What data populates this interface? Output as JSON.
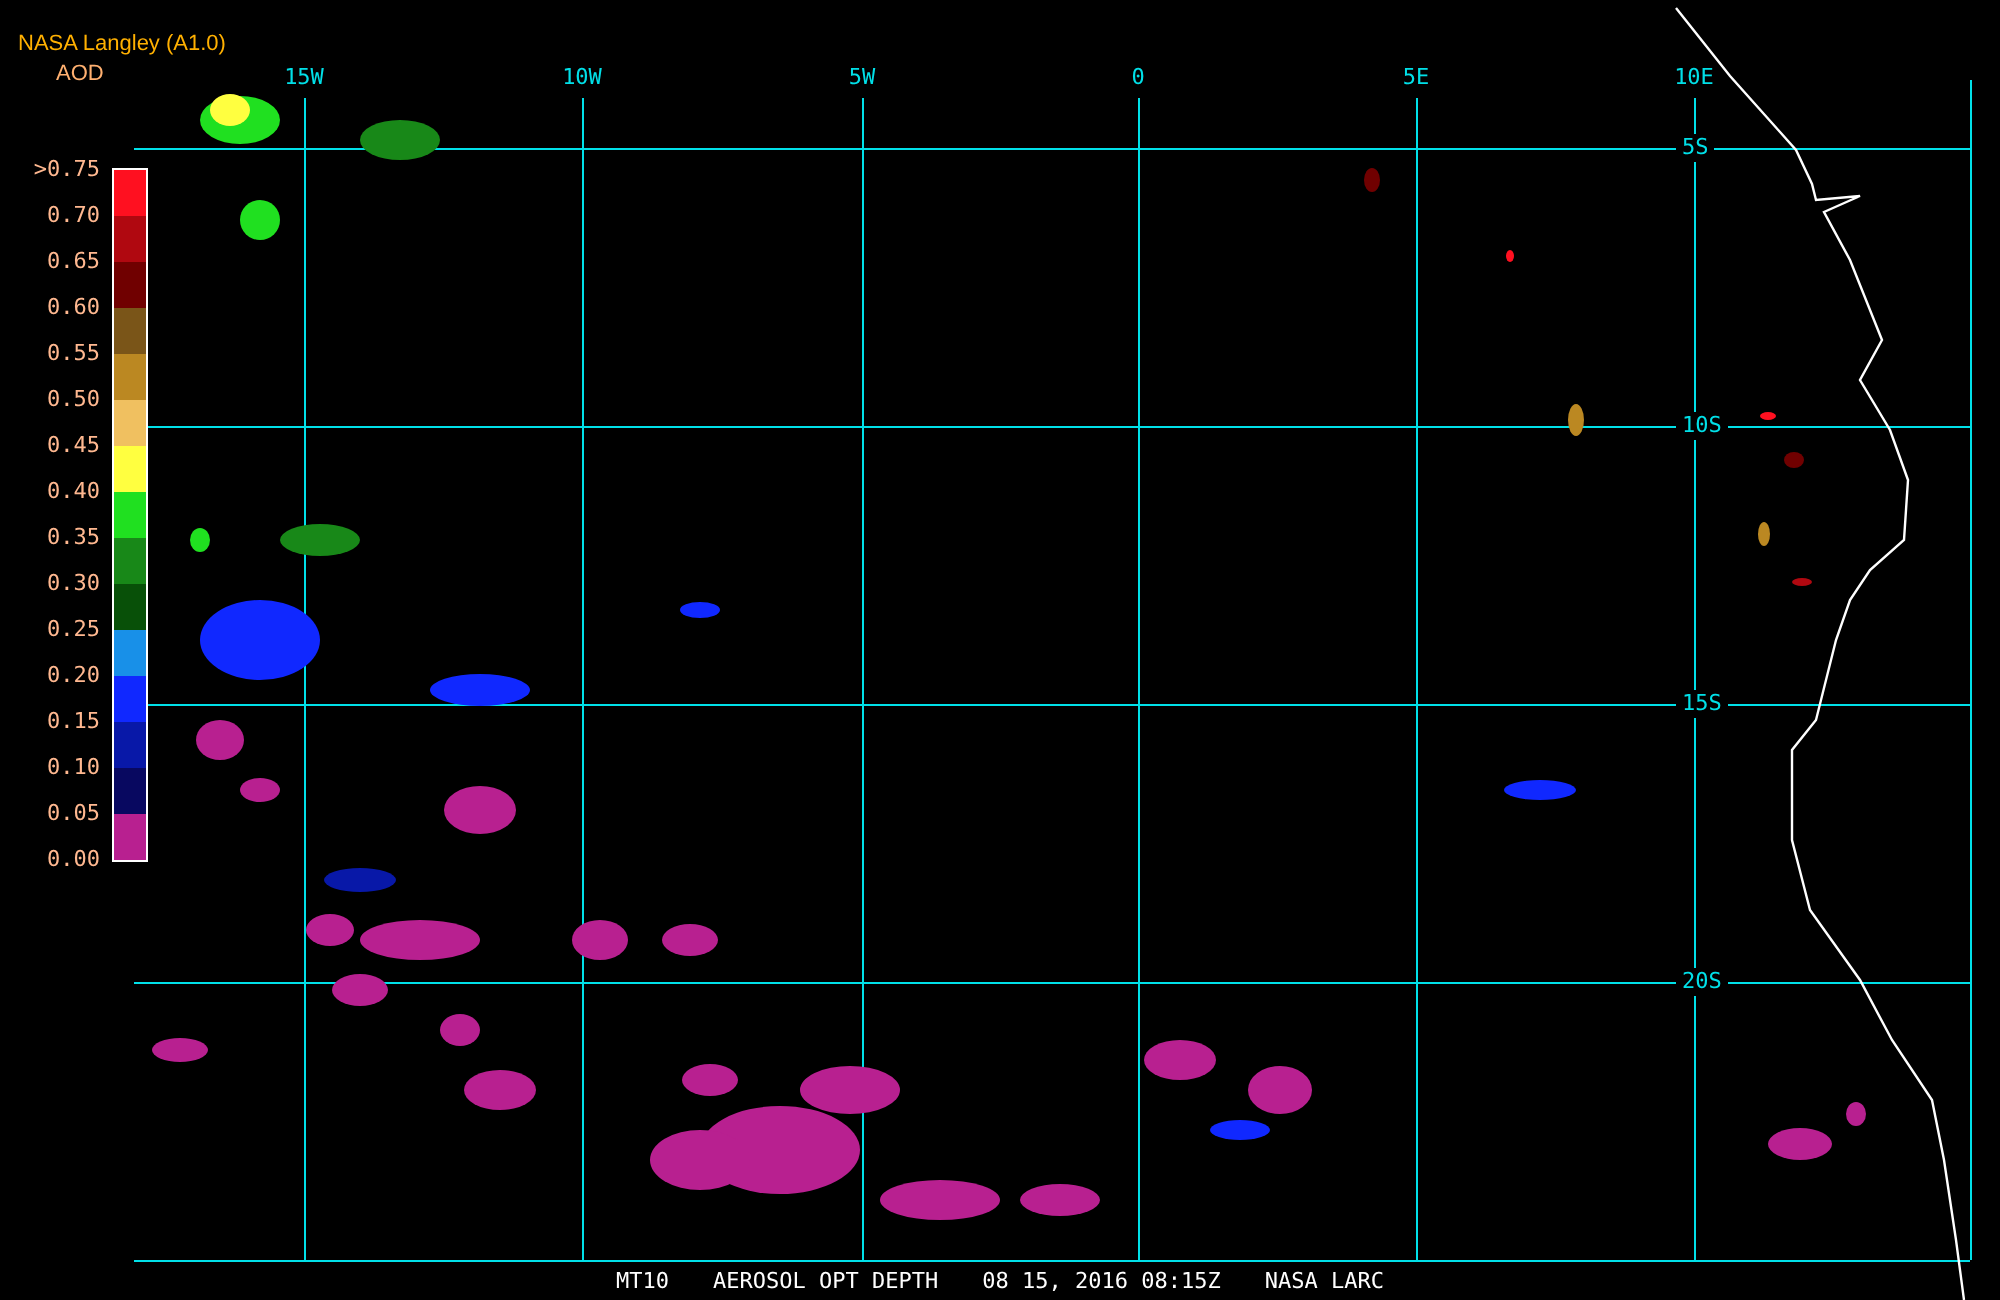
{
  "header": {
    "source": "NASA Langley (A1.0)",
    "variable": "AOD"
  },
  "legend": {
    "ticks": [
      ">0.75",
      "0.70",
      "0.65",
      "0.60",
      "0.55",
      "0.50",
      "0.45",
      "0.40",
      "0.35",
      "0.30",
      "0.25",
      "0.20",
      "0.15",
      "0.10",
      "0.05",
      "0.00"
    ],
    "bins": [
      {
        "color": "#ff1020"
      },
      {
        "color": "#b00810"
      },
      {
        "color": "#700000"
      },
      {
        "color": "#7a5518"
      },
      {
        "color": "#bb8822"
      },
      {
        "color": "#f0c060"
      },
      {
        "color": "#ffff40"
      },
      {
        "color": "#20e020"
      },
      {
        "color": "#188818"
      },
      {
        "color": "#085008"
      },
      {
        "color": "#1890e8"
      },
      {
        "color": "#1028ff"
      },
      {
        "color": "#0818a8"
      },
      {
        "color": "#080860"
      },
      {
        "color": "#b82090"
      }
    ]
  },
  "longitude_labels": [
    "15W",
    "10W",
    "5W",
    "0",
    "5E",
    "10E"
  ],
  "latitude_labels": [
    "5S",
    "10S",
    "15S",
    "20S"
  ],
  "footer": {
    "satellite": "MT10",
    "product": "AEROSOL OPT DEPTH",
    "datetime": "08 15, 2016 08:15Z",
    "credit": "NASA LARC"
  }
}
